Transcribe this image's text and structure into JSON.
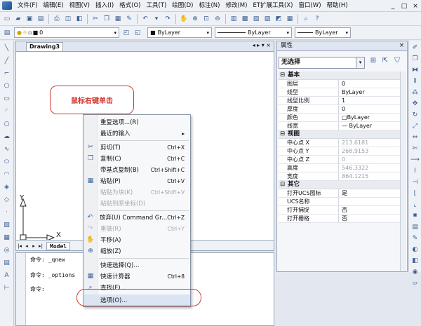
{
  "menubar": {
    "items": [
      "文件(F)",
      "编辑(E)",
      "视图(V)",
      "插入(I)",
      "格式(O)",
      "工具(T)",
      "绘图(D)",
      "标注(N)",
      "修改(M)",
      "ET扩展工具(X)",
      "窗口(W)",
      "帮助(H)"
    ]
  },
  "window_controls": {
    "min": "_",
    "max": "□",
    "close": "×"
  },
  "layer_combo": {
    "value": "0"
  },
  "style_combos": {
    "color": "ByLayer",
    "linetype": "ByLayer",
    "lineweight": "ByLayer"
  },
  "drawing": {
    "tab_title": "Drawing3",
    "tab_controls": "◂ ▸ ▾ ×"
  },
  "layout_tab": {
    "model_label": "Model"
  },
  "axes": {
    "x_label": "X",
    "y_label": "Y"
  },
  "callout": {
    "text": "鼠标右键单击"
  },
  "command_lines": [
    "命令: _qnew",
    "命令: _options",
    "命令:"
  ],
  "properties": {
    "title": "属性",
    "selection": "无选择",
    "sections": [
      {
        "name": "基本",
        "rows": [
          {
            "k": "图层",
            "v": "0"
          },
          {
            "k": "线型",
            "v": "ByLayer"
          },
          {
            "k": "线型比例",
            "v": "1"
          },
          {
            "k": "厚度",
            "v": "0"
          },
          {
            "k": "颜色",
            "v": "ByLayer"
          },
          {
            "k": "线宽",
            "v": "— ByLayer"
          }
        ]
      },
      {
        "name": "视图",
        "rows": [
          {
            "k": "中心点 X",
            "v": "213.6181"
          },
          {
            "k": "中心点 Y",
            "v": "268.9153"
          },
          {
            "k": "中心点 Z",
            "v": "0"
          },
          {
            "k": "高度",
            "v": "546.3322"
          },
          {
            "k": "宽度",
            "v": "864.1215"
          }
        ]
      },
      {
        "name": "其它",
        "rows": [
          {
            "k": "打开UCS图标",
            "v": "是"
          },
          {
            "k": "UCS名称",
            "v": ""
          },
          {
            "k": "打开捕捉",
            "v": "否"
          },
          {
            "k": "打开栅格",
            "v": "否"
          }
        ]
      }
    ]
  },
  "context_menu": {
    "items": [
      {
        "label": "重复选项...(R)",
        "shortcut": "",
        "icon": ""
      },
      {
        "label": "最近的输入",
        "shortcut": "▸",
        "icon": ""
      },
      {
        "label": "剪切(T)",
        "shortcut": "Ctrl+X",
        "icon": "scissors-icon"
      },
      {
        "label": "复制(C)",
        "shortcut": "Ctrl+C",
        "icon": "copy-icon"
      },
      {
        "label": "带基点复制(B)",
        "shortcut": "Ctrl+Shift+C",
        "icon": ""
      },
      {
        "label": "粘贴(P)",
        "shortcut": "Ctrl+V",
        "icon": "paste-icon"
      },
      {
        "label": "粘贴为块(K)",
        "shortcut": "Ctrl+Shift+V",
        "icon": ""
      },
      {
        "label": "粘贴到原坐标(D)",
        "shortcut": "",
        "icon": ""
      },
      {
        "label": "放弃(U) Command Gr...",
        "shortcut": "Ctrl+Z",
        "icon": "undo-icon"
      },
      {
        "label": "重做(R)",
        "shortcut": "Ctrl+Y",
        "icon": "redo-icon"
      },
      {
        "label": "平移(A)",
        "shortcut": "",
        "icon": "pan-icon"
      },
      {
        "label": "缩放(Z)",
        "shortcut": "",
        "icon": "zoom-icon"
      },
      {
        "label": "快速选择(Q)...",
        "shortcut": "",
        "icon": ""
      },
      {
        "label": "快速计算器",
        "shortcut": "Ctrl+8",
        "icon": "calculator-icon"
      },
      {
        "label": "查找(F)...",
        "shortcut": "",
        "icon": "find-icon"
      },
      {
        "label": "选项(O)...",
        "shortcut": "",
        "icon": ""
      }
    ]
  }
}
